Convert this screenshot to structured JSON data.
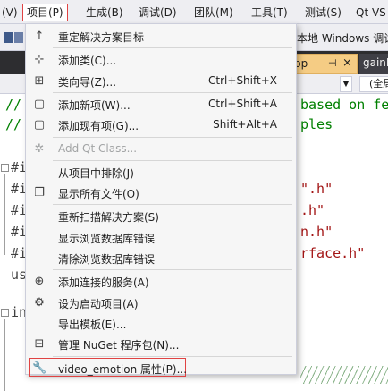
{
  "menubar": {
    "items": [
      {
        "label": "(V)"
      },
      {
        "label": "项目(P)"
      },
      {
        "label": "生成(B)"
      },
      {
        "label": "调试(D)"
      },
      {
        "label": "团队(M)"
      },
      {
        "label": "工具(T)"
      },
      {
        "label": "测试(S)"
      },
      {
        "label": "Qt VS"
      }
    ]
  },
  "toolbar": {
    "target_label": "本地 Windows 调试"
  },
  "tabs": {
    "active_label": "pp",
    "pin_glyph": "⊣",
    "close_glyph": "×",
    "other_label": "gainL"
  },
  "navbar": {
    "scope_label": "(全局"
  },
  "editor": {
    "lines": [
      {
        "text": "based on fe",
        "type": "comment"
      },
      {
        "text": "ples",
        "type": "comment"
      },
      {
        "text": "\".h\"",
        "type": "string"
      },
      {
        "text": ".h\"",
        "type": "string"
      },
      {
        "text": "n.h\"",
        "type": "string"
      },
      {
        "text": "rface.h\"",
        "type": "string"
      },
      {
        "text": "//////////",
        "type": "comment"
      }
    ],
    "gutter": [
      "//",
      "//",
      "#i",
      "#i",
      "#i",
      "#i",
      "#i",
      "us",
      "in"
    ]
  },
  "dropdown": {
    "items": [
      {
        "icon": "arrow-up-icon",
        "glyph": "↑",
        "label": "重定解决方案目标",
        "shortcut": "",
        "disabled": false
      },
      {
        "sep": true
      },
      {
        "icon": "add-class-icon",
        "glyph": "⊹",
        "label": "添加类(C)...",
        "shortcut": "",
        "disabled": false
      },
      {
        "icon": "class-wizard-icon",
        "glyph": "⊞",
        "label": "类向导(Z)...",
        "shortcut": "Ctrl+Shift+X",
        "disabled": false
      },
      {
        "sep": true
      },
      {
        "icon": "add-new-item-icon",
        "glyph": "▢",
        "label": "添加新项(W)...",
        "shortcut": "Ctrl+Shift+A",
        "disabled": false
      },
      {
        "icon": "add-existing-item-icon",
        "glyph": "▢",
        "label": "添加现有项(G)...",
        "shortcut": "Shift+Alt+A",
        "disabled": false
      },
      {
        "sep": true
      },
      {
        "icon": "qt-class-icon",
        "glyph": "✲",
        "label": "Add Qt Class...",
        "shortcut": "",
        "disabled": true
      },
      {
        "sep": true
      },
      {
        "icon": "",
        "glyph": "",
        "label": "从项目中排除(J)",
        "shortcut": "",
        "disabled": false
      },
      {
        "icon": "show-all-files-icon",
        "glyph": "❐",
        "label": "显示所有文件(O)",
        "shortcut": "",
        "disabled": false
      },
      {
        "sep": true
      },
      {
        "icon": "",
        "glyph": "",
        "label": "重新扫描解决方案(S)",
        "shortcut": "",
        "disabled": false
      },
      {
        "icon": "",
        "glyph": "",
        "label": "显示浏览数据库错误",
        "shortcut": "",
        "disabled": false
      },
      {
        "icon": "",
        "glyph": "",
        "label": "清除浏览数据库错误",
        "shortcut": "",
        "disabled": false
      },
      {
        "sep": true
      },
      {
        "icon": "add-connected-service-icon",
        "glyph": "⊕",
        "label": "添加连接的服务(A)",
        "shortcut": "",
        "disabled": false
      },
      {
        "icon": "set-startup-gear-icon",
        "glyph": "⚙",
        "label": "设为启动项目(A)",
        "shortcut": "",
        "disabled": false
      },
      {
        "icon": "",
        "glyph": "",
        "label": "导出模板(E)...",
        "shortcut": "",
        "disabled": false
      },
      {
        "icon": "nuget-package-icon",
        "glyph": "⊟",
        "label": "管理 NuGet 程序包(N)...",
        "shortcut": "",
        "disabled": false
      },
      {
        "sep": true
      },
      {
        "icon": "wrench-icon",
        "glyph": "🔧",
        "label": "video_emotion 属性(P)...",
        "shortcut": "",
        "disabled": false,
        "highlight": true
      }
    ]
  },
  "colors": {
    "menubar_bg": "#eeeef2",
    "highlight_border": "#e04343",
    "tab_active_bg": "#f5cc84",
    "comment": "#008000",
    "string": "#a31515"
  }
}
